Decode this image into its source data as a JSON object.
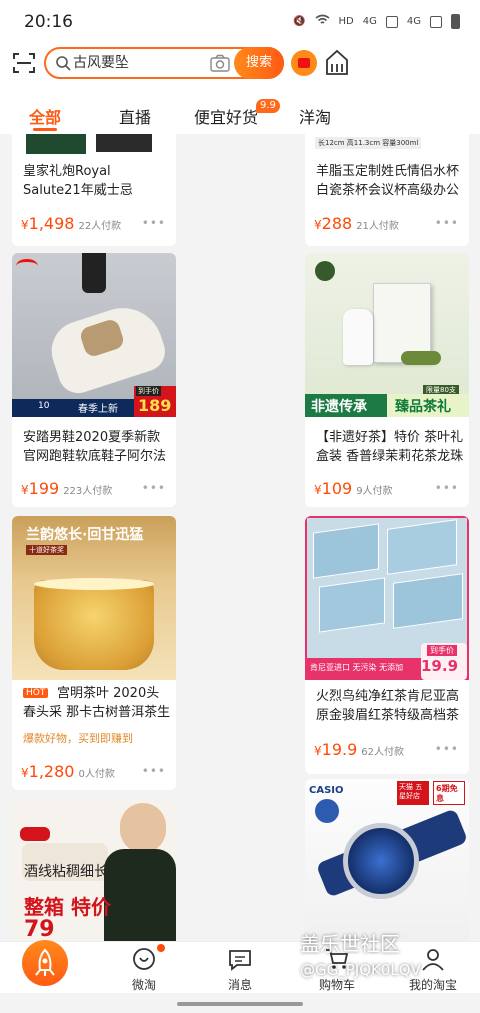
{
  "status": {
    "time": "20:16",
    "net1": "HD",
    "net2": "4G",
    "net3": "4G"
  },
  "search": {
    "value": "古风要坠",
    "button": "搜索"
  },
  "tabs": [
    {
      "label": "全部"
    },
    {
      "label": "直播"
    },
    {
      "label": "便宜好货"
    },
    {
      "label": "洋淘"
    }
  ],
  "tab_badge": "9.9",
  "cards": {
    "c1": {
      "title": "皇家礼炮Royal Salute21年威士忌",
      "currency": "¥",
      "price": "1,498",
      "sold": "22人付款"
    },
    "c2": {
      "title": "羊脂玉定制姓氏情侣水杯白瓷茶杯会议杯高级办公室带",
      "currency": "¥",
      "price": "288",
      "sold": "21人付款",
      "img_text": "长12cm 高11.3cm 容量300ml"
    },
    "c3": {
      "title": "安踏男鞋2020夏季新款官网跑鞋软底鞋子阿尔法跑步",
      "currency": "¥",
      "price": "199",
      "sold": "223人付款",
      "img_tag": "到手价",
      "img_price": "189",
      "img_banner": "春季上新",
      "img_small": "10"
    },
    "c4": {
      "title": "【非遗好茶】特价 茶叶礼盒装 香普绿茉莉花茶龙珠",
      "currency": "¥",
      "price": "109",
      "sold": "9人付款",
      "img_left": "非遗传承",
      "img_right": "臻品茶礼",
      "img_tag": "限量80支"
    },
    "c5": {
      "title": "宫明茶叶 2020头春头采 那卡古树普洱茶生茶",
      "badge": "HOT",
      "currency": "¥",
      "price": "1,280",
      "sold": "0人付款",
      "promo": "爆款好物，买到即赚到",
      "img_line1": "兰韵悠长·回甘迅猛",
      "img_line2": "十道好茶奖"
    },
    "c6": {
      "title": "火烈鸟纯净红茶肯尼亚高原金骏眉红茶特级高档茶包浓",
      "currency": "¥",
      "price": "19.9",
      "sold": "62人付款",
      "img_banner": "肯尼亚进口 无污染 无添加",
      "img_tag": "到手价",
      "img_price": "19.9"
    },
    "c7": {
      "img_line1": "酒线粘稠细长",
      "img_line2": "整箱 特价",
      "img_price": "79"
    },
    "c8": {
      "img_brand": "CASIO",
      "img_tag": "天猫 五星好店",
      "img_tag2": "6期免息"
    }
  },
  "nav": [
    {
      "label": ""
    },
    {
      "label": "微淘"
    },
    {
      "label": "消息"
    },
    {
      "label": "购物车"
    },
    {
      "label": "我的淘宝"
    }
  ],
  "watermark": {
    "line1": "盖乐世社区",
    "line2": "@GG_PJQK0LQV"
  },
  "colors": {
    "accent": "#ff5a14",
    "price": "#ff4a0a"
  }
}
